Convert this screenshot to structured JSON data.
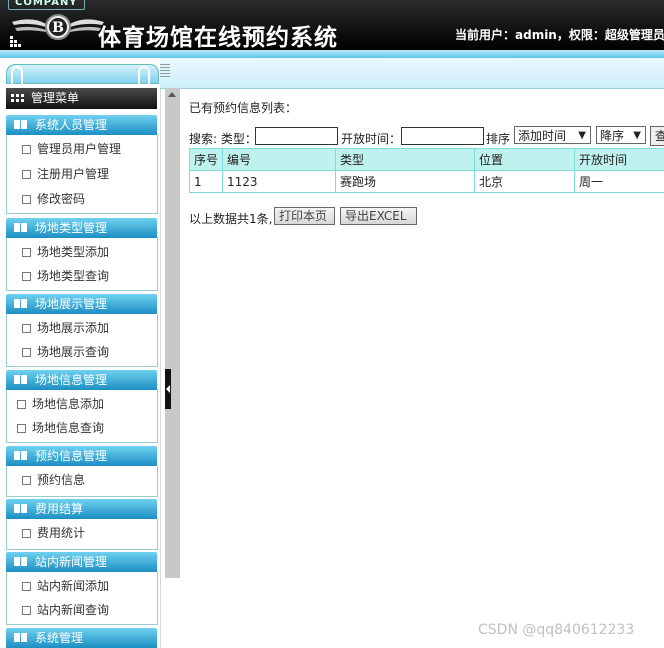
{
  "header": {
    "company": "COMPANY",
    "title": "体育场馆在线预约系统",
    "user_info": "当前用户：admin，权限：超级管理员"
  },
  "sidebar": {
    "main_menu": "管理菜单",
    "groups": [
      {
        "title": "系统人员管理",
        "items": [
          "管理员用户管理",
          "注册用户管理",
          "修改密码"
        ]
      },
      {
        "title": "场地类型管理",
        "items": [
          "场地类型添加",
          "场地类型查询"
        ]
      },
      {
        "title": "场地展示管理",
        "items": [
          "场地展示添加",
          "场地展示查询"
        ]
      },
      {
        "title": "场地信息管理",
        "items": [
          "场地信息添加",
          "场地信息查询"
        ]
      },
      {
        "title": "预约信息管理",
        "items": [
          "预约信息"
        ]
      },
      {
        "title": "费用结算",
        "items": [
          "费用统计"
        ]
      },
      {
        "title": "站内新闻管理",
        "items": [
          "站内新闻添加",
          "站内新闻查询"
        ]
      },
      {
        "title": "系统管理",
        "items": []
      }
    ]
  },
  "content": {
    "list_title": "已有预约信息列表：",
    "search": {
      "label_search_type": "搜索: 类型：",
      "type_value": "",
      "label_open_time": "开放时间：",
      "open_time_value": "",
      "label_sort": "排序",
      "sort_field": "添加时间",
      "sort_order": "降序",
      "search_button": "查"
    },
    "table": {
      "headers": [
        "序号",
        "编号",
        "类型",
        "位置",
        "开放时间"
      ],
      "rows": [
        [
          "1",
          "1123",
          "赛跑场",
          "北京",
          "周一"
        ]
      ]
    },
    "footer": {
      "summary": "以上数据共1条,",
      "print_button": "打印本页",
      "export_button": "导出EXCEL"
    }
  },
  "watermark": "CSDN @qq840612233"
}
